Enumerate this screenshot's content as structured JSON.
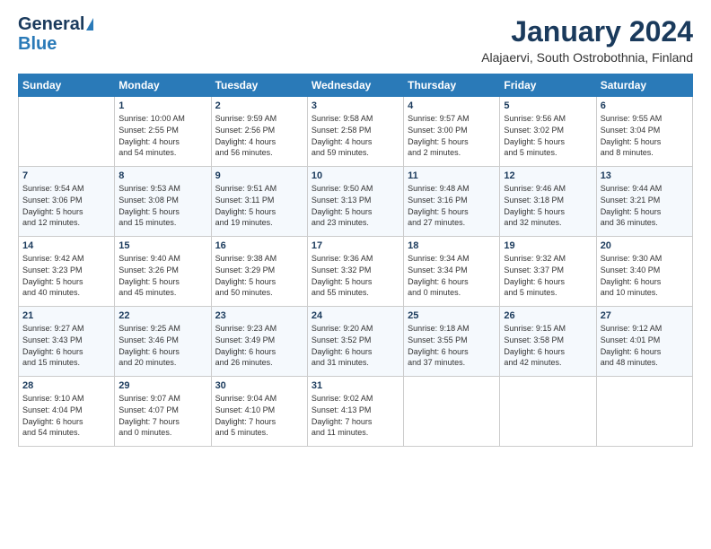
{
  "logo": {
    "line1": "General",
    "line2": "Blue"
  },
  "title": "January 2024",
  "subtitle": "Alajaervi, South Ostrobothnia, Finland",
  "weekdays": [
    "Sunday",
    "Monday",
    "Tuesday",
    "Wednesday",
    "Thursday",
    "Friday",
    "Saturday"
  ],
  "weeks": [
    [
      {
        "day": "",
        "info": ""
      },
      {
        "day": "1",
        "info": "Sunrise: 10:00 AM\nSunset: 2:55 PM\nDaylight: 4 hours\nand 54 minutes."
      },
      {
        "day": "2",
        "info": "Sunrise: 9:59 AM\nSunset: 2:56 PM\nDaylight: 4 hours\nand 56 minutes."
      },
      {
        "day": "3",
        "info": "Sunrise: 9:58 AM\nSunset: 2:58 PM\nDaylight: 4 hours\nand 59 minutes."
      },
      {
        "day": "4",
        "info": "Sunrise: 9:57 AM\nSunset: 3:00 PM\nDaylight: 5 hours\nand 2 minutes."
      },
      {
        "day": "5",
        "info": "Sunrise: 9:56 AM\nSunset: 3:02 PM\nDaylight: 5 hours\nand 5 minutes."
      },
      {
        "day": "6",
        "info": "Sunrise: 9:55 AM\nSunset: 3:04 PM\nDaylight: 5 hours\nand 8 minutes."
      }
    ],
    [
      {
        "day": "7",
        "info": "Sunrise: 9:54 AM\nSunset: 3:06 PM\nDaylight: 5 hours\nand 12 minutes."
      },
      {
        "day": "8",
        "info": "Sunrise: 9:53 AM\nSunset: 3:08 PM\nDaylight: 5 hours\nand 15 minutes."
      },
      {
        "day": "9",
        "info": "Sunrise: 9:51 AM\nSunset: 3:11 PM\nDaylight: 5 hours\nand 19 minutes."
      },
      {
        "day": "10",
        "info": "Sunrise: 9:50 AM\nSunset: 3:13 PM\nDaylight: 5 hours\nand 23 minutes."
      },
      {
        "day": "11",
        "info": "Sunrise: 9:48 AM\nSunset: 3:16 PM\nDaylight: 5 hours\nand 27 minutes."
      },
      {
        "day": "12",
        "info": "Sunrise: 9:46 AM\nSunset: 3:18 PM\nDaylight: 5 hours\nand 32 minutes."
      },
      {
        "day": "13",
        "info": "Sunrise: 9:44 AM\nSunset: 3:21 PM\nDaylight: 5 hours\nand 36 minutes."
      }
    ],
    [
      {
        "day": "14",
        "info": "Sunrise: 9:42 AM\nSunset: 3:23 PM\nDaylight: 5 hours\nand 40 minutes."
      },
      {
        "day": "15",
        "info": "Sunrise: 9:40 AM\nSunset: 3:26 PM\nDaylight: 5 hours\nand 45 minutes."
      },
      {
        "day": "16",
        "info": "Sunrise: 9:38 AM\nSunset: 3:29 PM\nDaylight: 5 hours\nand 50 minutes."
      },
      {
        "day": "17",
        "info": "Sunrise: 9:36 AM\nSunset: 3:32 PM\nDaylight: 5 hours\nand 55 minutes."
      },
      {
        "day": "18",
        "info": "Sunrise: 9:34 AM\nSunset: 3:34 PM\nDaylight: 6 hours\nand 0 minutes."
      },
      {
        "day": "19",
        "info": "Sunrise: 9:32 AM\nSunset: 3:37 PM\nDaylight: 6 hours\nand 5 minutes."
      },
      {
        "day": "20",
        "info": "Sunrise: 9:30 AM\nSunset: 3:40 PM\nDaylight: 6 hours\nand 10 minutes."
      }
    ],
    [
      {
        "day": "21",
        "info": "Sunrise: 9:27 AM\nSunset: 3:43 PM\nDaylight: 6 hours\nand 15 minutes."
      },
      {
        "day": "22",
        "info": "Sunrise: 9:25 AM\nSunset: 3:46 PM\nDaylight: 6 hours\nand 20 minutes."
      },
      {
        "day": "23",
        "info": "Sunrise: 9:23 AM\nSunset: 3:49 PM\nDaylight: 6 hours\nand 26 minutes."
      },
      {
        "day": "24",
        "info": "Sunrise: 9:20 AM\nSunset: 3:52 PM\nDaylight: 6 hours\nand 31 minutes."
      },
      {
        "day": "25",
        "info": "Sunrise: 9:18 AM\nSunset: 3:55 PM\nDaylight: 6 hours\nand 37 minutes."
      },
      {
        "day": "26",
        "info": "Sunrise: 9:15 AM\nSunset: 3:58 PM\nDaylight: 6 hours\nand 42 minutes."
      },
      {
        "day": "27",
        "info": "Sunrise: 9:12 AM\nSunset: 4:01 PM\nDaylight: 6 hours\nand 48 minutes."
      }
    ],
    [
      {
        "day": "28",
        "info": "Sunrise: 9:10 AM\nSunset: 4:04 PM\nDaylight: 6 hours\nand 54 minutes."
      },
      {
        "day": "29",
        "info": "Sunrise: 9:07 AM\nSunset: 4:07 PM\nDaylight: 7 hours\nand 0 minutes."
      },
      {
        "day": "30",
        "info": "Sunrise: 9:04 AM\nSunset: 4:10 PM\nDaylight: 7 hours\nand 5 minutes."
      },
      {
        "day": "31",
        "info": "Sunrise: 9:02 AM\nSunset: 4:13 PM\nDaylight: 7 hours\nand 11 minutes."
      },
      {
        "day": "",
        "info": ""
      },
      {
        "day": "",
        "info": ""
      },
      {
        "day": "",
        "info": ""
      }
    ]
  ]
}
